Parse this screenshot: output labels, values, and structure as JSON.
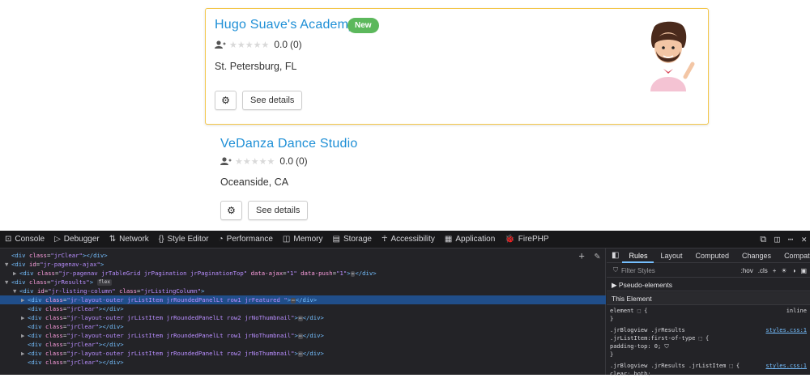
{
  "listings": [
    {
      "title": "Hugo Suave's Academy",
      "badge": "New",
      "rating": "0.0",
      "count": "(0)",
      "location": "St. Petersburg, FL",
      "details_label": "See details",
      "gear_icon": "gear-icon"
    },
    {
      "title": "VeDanza Dance Studio",
      "rating": "0.0",
      "count": "(0)",
      "location": "Oceanside, CA",
      "details_label": "See details",
      "gear_icon": "gear-icon"
    }
  ],
  "devtools": {
    "tabs": [
      {
        "icon": "console-icon",
        "label": "Console"
      },
      {
        "icon": "debugger-icon",
        "label": "Debugger"
      },
      {
        "icon": "network-icon",
        "label": "Network"
      },
      {
        "icon": "style-editor-icon",
        "label": "Style Editor"
      },
      {
        "icon": "performance-icon",
        "label": "Performance"
      },
      {
        "icon": "memory-icon",
        "label": "Memory"
      },
      {
        "icon": "storage-icon",
        "label": "Storage"
      },
      {
        "icon": "accessibility-icon",
        "label": "Accessibility"
      },
      {
        "icon": "application-icon",
        "label": "Application"
      },
      {
        "icon": "firephp-icon",
        "label": "FirePHP"
      }
    ],
    "html_lines": [
      {
        "indent": 0,
        "tag": "div",
        "attrs": [
          [
            "class",
            "jrClear"
          ]
        ],
        "close": true,
        "text": ""
      },
      {
        "indent": 0,
        "tag": "div",
        "attrs": [
          [
            "id",
            "jr-pagenav-ajax"
          ]
        ],
        "close": false,
        "text": "",
        "arrow": "▼"
      },
      {
        "indent": 1,
        "tag": "div",
        "attrs": [
          [
            "class",
            "jr-pagenav jrTableGrid jrPagination jrPaginationTop"
          ],
          [
            "data-ajax",
            "1"
          ],
          [
            "data-push",
            "1"
          ]
        ],
        "close": true,
        "ell": true,
        "arrow": "▶"
      },
      {
        "indent": 0,
        "tag": "div",
        "attrs": [
          [
            "class",
            "jrResults"
          ]
        ],
        "close": false,
        "flex": "flex",
        "arrow": "▼"
      },
      {
        "indent": 1,
        "tag": "div",
        "attrs": [
          [
            "id",
            "jr-listing-column"
          ],
          [
            "class",
            "jrListingColumn"
          ]
        ],
        "close": false,
        "arrow": "▼"
      },
      {
        "indent": 2,
        "tag": "div",
        "attrs": [
          [
            "class",
            "jr-layout-outer jrListItem jrRoundedPanelLt row1 jrFeatured "
          ]
        ],
        "close": true,
        "ell": true,
        "arrow": "▶",
        "selected": true
      },
      {
        "indent": 2,
        "tag": "div",
        "attrs": [
          [
            "class",
            "jrClear"
          ]
        ],
        "close": true
      },
      {
        "indent": 2,
        "tag": "div",
        "attrs": [
          [
            "class",
            "jr-layout-outer jrListItem jrRoundedPanelLt row2 jrNoThumbnail"
          ]
        ],
        "close": true,
        "ell": true,
        "arrow": "▶"
      },
      {
        "indent": 2,
        "tag": "div",
        "attrs": [
          [
            "class",
            "jrClear"
          ]
        ],
        "close": true
      },
      {
        "indent": 2,
        "tag": "div",
        "attrs": [
          [
            "class",
            "jr-layout-outer jrListItem jrRoundedPanelLt row1 jrNoThumbnail"
          ]
        ],
        "close": true,
        "ell": true,
        "arrow": "▶"
      },
      {
        "indent": 2,
        "tag": "div",
        "attrs": [
          [
            "class",
            "jrClear"
          ]
        ],
        "close": true
      },
      {
        "indent": 2,
        "tag": "div",
        "attrs": [
          [
            "class",
            "jr-layout-outer jrListItem jrRoundedPanelLt row2 jrNoThumbnail"
          ]
        ],
        "close": true,
        "ell": true,
        "arrow": "▶"
      },
      {
        "indent": 2,
        "tag": "div",
        "attrs": [
          [
            "class",
            "jrClear"
          ]
        ],
        "close": true
      }
    ],
    "right_tabs": [
      "Rules",
      "Layout",
      "Computed",
      "Changes",
      "Compat"
    ],
    "filter_placeholder": "Filter Styles",
    "filter_tools": [
      ":hov",
      ".cls",
      "+",
      "☀",
      "◑",
      "▣"
    ],
    "pseudo_elements": "Pseudo-elements",
    "this_element": "This Element",
    "rules": [
      {
        "text": "element ⬚ {",
        "src": "inline"
      },
      {
        "text": "}",
        "src": ""
      },
      {
        "text": ".jrBlogview .jrResults",
        "src": "styles.css:1"
      },
      {
        "text": ".jrListItem:first-of-type ⬚ {",
        "src": ""
      },
      {
        "text": "   padding-top: 0;  ⛉",
        "src": ""
      },
      {
        "text": "}",
        "src": ""
      },
      {
        "text": ".jrBlogview .jrResults .jrListItem ⬚ {",
        "src": "styles.css:1"
      },
      {
        "text": "   clear: both;",
        "src": ""
      }
    ]
  }
}
